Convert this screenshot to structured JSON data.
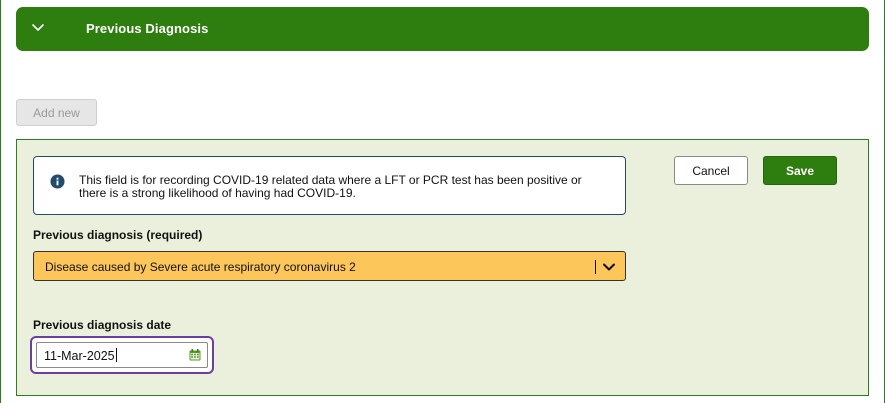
{
  "accordion": {
    "title": "Previous Diagnosis"
  },
  "actions": {
    "add_new_label": "Add new",
    "cancel_label": "Cancel",
    "save_label": "Save"
  },
  "info": {
    "icon": "info-icon",
    "text": "This field is for recording COVID-19 related data where a LFT or PCR test has been positive or there is a strong likelihood of having had COVID-19."
  },
  "diagnosis": {
    "label": "Previous diagnosis (required)",
    "selected_value": "Disease caused by Severe acute respiratory coronavirus 2"
  },
  "diagnosis_date": {
    "label": "Previous diagnosis date",
    "value": "11-Mar-2025",
    "icon": "calendar-icon"
  },
  "colors": {
    "brand_green": "#2e7d0f",
    "panel_bg": "#eaf0dc",
    "select_highlight": "#fcc65a",
    "focus_ring": "#6b3fa0",
    "info_icon": "#1f4d6b"
  }
}
